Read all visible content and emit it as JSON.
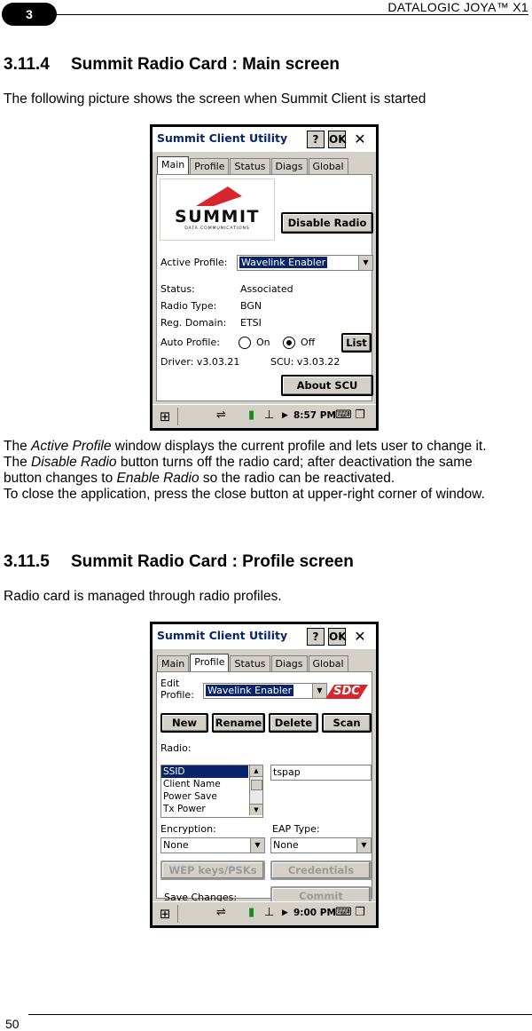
{
  "header": {
    "chapter": "3",
    "title": "DATALOGIC JOYA™ X1"
  },
  "footer": {
    "page_number": "50"
  },
  "section1": {
    "number": "3.11.4",
    "title": "Summit Radio Card : Main screen",
    "intro": "The following picture shows the screen when Summit Client is started",
    "desc": {
      "l1_pre": "The ",
      "l1_em": "Active Profile",
      "l1_post": " window displays the current profile and lets user to change it.",
      "l2_pre": "The ",
      "l2_em": "Disable Radio",
      "l2_post": " button turns off the radio card; after deactivation the same",
      "l3_pre": "button changes to ",
      "l3_em": "Enable Radio",
      "l3_post": " so the radio can be reactivated.",
      "l4": "To close the application, press the close button at upper-right corner of window."
    }
  },
  "section2": {
    "number": "3.11.5",
    "title": "Summit Radio Card : Profile screen",
    "intro": "Radio card is managed through radio profiles."
  },
  "app": {
    "window_title": "Summit Client Utility",
    "help_label": "?",
    "ok_label": "OK",
    "close_label": "✕",
    "tabs": [
      "Main",
      "Profile",
      "Status",
      "Diags",
      "Global"
    ],
    "taskbar_time_main": "8:57 PM",
    "taskbar_time_profile": "9:00 PM"
  },
  "main_screen": {
    "logo_text": "SUMMIT",
    "logo_subtext": "DATA COMMUNICATIONS",
    "disable_radio_label": "Disable Radio",
    "active_profile_label": "Active Profile:",
    "active_profile_value": "Wavelink Enabler",
    "status_label": "Status:",
    "status_value": "Associated",
    "radio_type_label": "Radio Type:",
    "radio_type_value": "BGN",
    "reg_domain_label": "Reg. Domain:",
    "reg_domain_value": "ETSI",
    "auto_profile_label": "Auto Profile:",
    "auto_on_label": "On",
    "auto_off_label": "Off",
    "list_label": "List",
    "driver_text": "Driver:   v3.03.21",
    "scu_text": "SCU: v3.03.22",
    "about_label": "About SCU"
  },
  "profile_screen": {
    "edit_profile_label_1": "Edit",
    "edit_profile_label_2": "Profile:",
    "profile_value": "Wavelink Enabler",
    "sdc_logo": "SDC",
    "new_label": "New",
    "rename_label": "Rename",
    "delete_label": "Delete",
    "scan_label": "Scan",
    "radio_label": "Radio:",
    "radio_items": [
      "SSID",
      "Client Name",
      "Power Save",
      "Tx Power"
    ],
    "ssid_value": "tspap",
    "encryption_label": "Encryption:",
    "encryption_value": "None",
    "eap_label": "EAP Type:",
    "eap_value": "None",
    "wep_label": "WEP keys/PSKs",
    "credentials_label": "Credentials",
    "save_changes_label": "Save Changes:",
    "commit_label": "Commit"
  },
  "colors": {
    "title_blue": "#0a246a",
    "logo_red": "#d8262e",
    "selection_blue": "#0a246a"
  }
}
